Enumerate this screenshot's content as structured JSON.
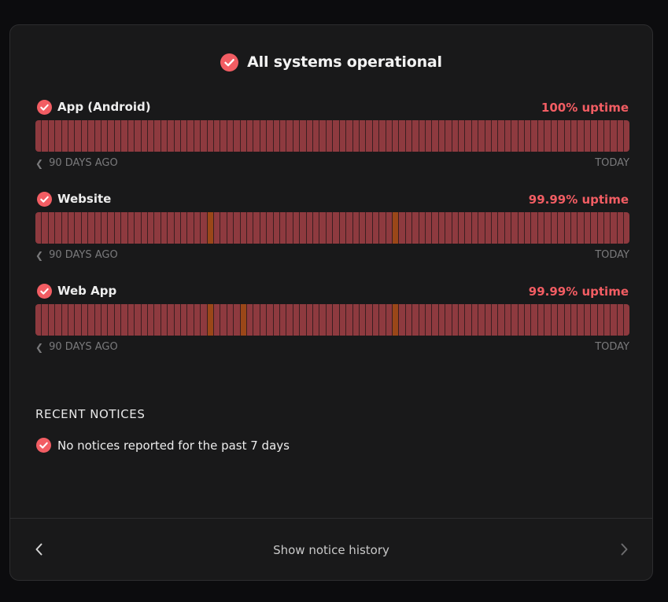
{
  "header": {
    "title": "All systems operational",
    "icon": "check-circle-icon"
  },
  "colors": {
    "accent": "#f25d63",
    "bar_up": "#8e3a3f",
    "bar_degraded": "#9a4718",
    "background": "#19191a"
  },
  "monitors": [
    {
      "name": "App (Android)",
      "uptime": "100% uptime",
      "left_label": "90 DAYS AGO",
      "right_label": "TODAY",
      "days": 90,
      "degraded_days": []
    },
    {
      "name": "Website",
      "uptime": "99.99% uptime",
      "left_label": "90 DAYS AGO",
      "right_label": "TODAY",
      "days": 90,
      "degraded_days": [
        26,
        54
      ]
    },
    {
      "name": "Web App",
      "uptime": "99.99% uptime",
      "left_label": "90 DAYS AGO",
      "right_label": "TODAY",
      "days": 90,
      "degraded_days": [
        26,
        31,
        54
      ]
    }
  ],
  "notices": {
    "title": "RECENT NOTICES",
    "empty_message": "No notices reported for the past 7 days"
  },
  "footer": {
    "history_label": "Show notice history",
    "prev_icon": "chevron-left-icon",
    "next_icon": "chevron-right-icon"
  }
}
